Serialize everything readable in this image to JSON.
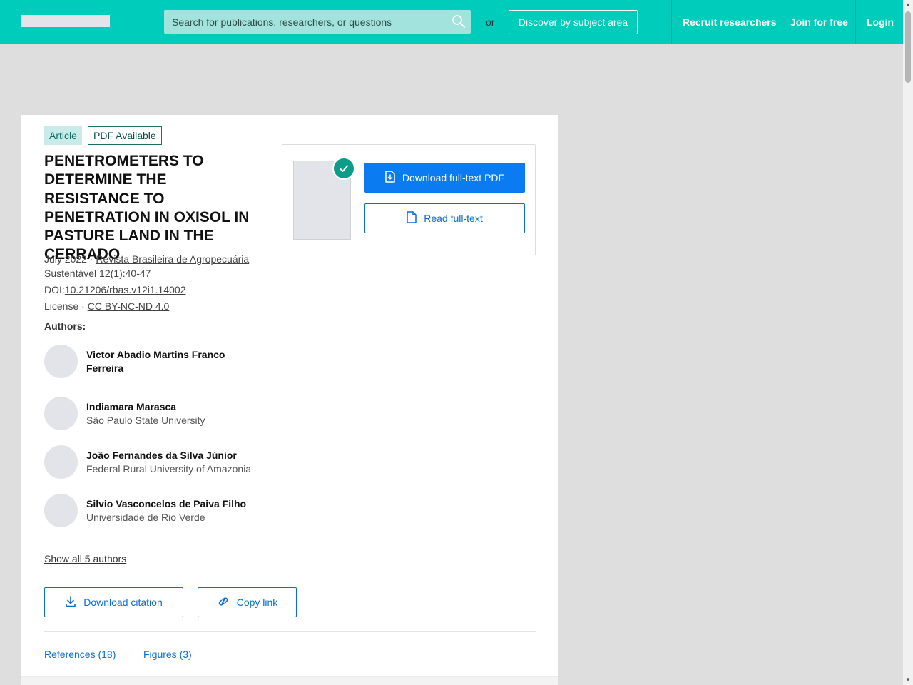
{
  "header": {
    "search_placeholder": "Search for publications, researchers, or questions",
    "or_text": "or",
    "discover_label": "Discover by subject area",
    "nav": {
      "recruit": "Recruit researchers",
      "join": "Join for free",
      "login": "Login"
    }
  },
  "article": {
    "badges": {
      "type": "Article",
      "pdf": "PDF Available"
    },
    "title": "PENETROMETERS TO DETERMINE THE RESISTANCE TO PENETRATION IN OXISOL IN PASTURE LAND IN THE CERRADO",
    "date": "July 2022",
    "date_sep": " · ",
    "journal": "Revista Brasileira de Agropecuária Sustentável",
    "issue": " 12(1):40-47",
    "doi_label": "DOI:",
    "doi": "10.21206/rbas.v12i1.14002",
    "license_label": "License · ",
    "license": "CC BY-NC-ND 4.0",
    "authors_label": "Authors:",
    "authors": [
      {
        "name": "Victor Abadio Martins Franco Ferreira",
        "affiliation": ""
      },
      {
        "name": "Indiamara Marasca",
        "affiliation": "São Paulo State University"
      },
      {
        "name": "João Fernandes da Silva Júnior",
        "affiliation": "Federal Rural University of Amazonia"
      },
      {
        "name": "Silvio Vasconcelos de Paiva Filho",
        "affiliation": "Universidade de Rio Verde"
      }
    ],
    "show_all": "Show all 5 authors",
    "actions": {
      "download_citation": "Download citation",
      "copy_link": "Copy link"
    },
    "tabs": {
      "references": "References (18)",
      "figures": "Figures (3)"
    }
  },
  "pdf_panel": {
    "download_label": "Download full-text PDF",
    "read_label": "Read full-text"
  },
  "colors": {
    "brand": "#00ccbb",
    "primary_button": "#0a7bf0",
    "link": "#0a6ed1",
    "check": "#0b9d8a"
  }
}
